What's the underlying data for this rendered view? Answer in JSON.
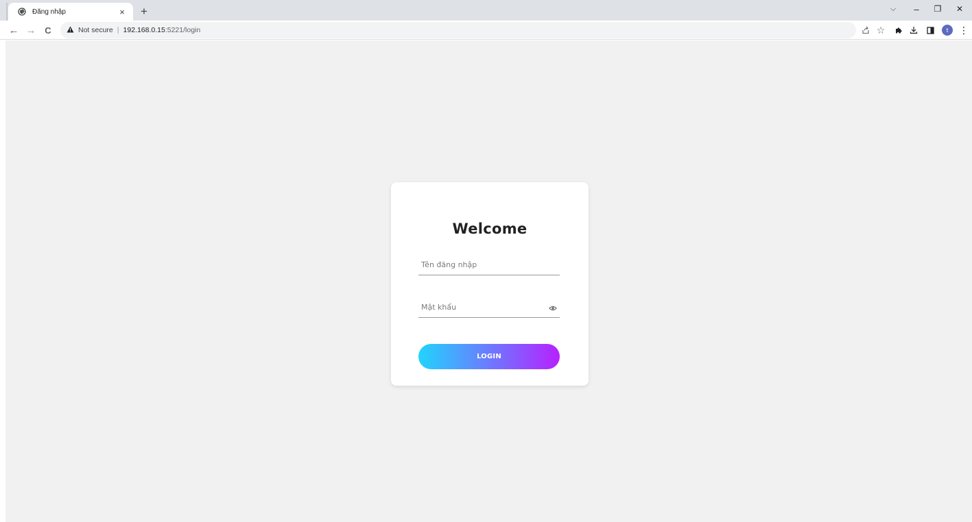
{
  "browser": {
    "tab": {
      "title": "Đăng nhập",
      "favicon": "globe-icon",
      "close": "×"
    },
    "new_tab": "+",
    "window_controls": {
      "tab_search": "⌵",
      "minimize": "–",
      "restore": "❐",
      "close": "✕"
    },
    "nav": {
      "back": "←",
      "forward": "→",
      "reload": "C"
    },
    "address": {
      "security_label": "Not secure",
      "separator": "|",
      "host": "192.168.0.15",
      "rest": ":5221/login"
    },
    "toolbar_icons": [
      "share-icon",
      "star-icon",
      "extensions-icon",
      "download-icon",
      "sidepanel-icon"
    ],
    "profile_initial": "t",
    "menu": "⋮"
  },
  "login": {
    "title": "Welcome",
    "username_placeholder": "Tên đăng nhập",
    "password_placeholder": "Mật khẩu",
    "button_label": "LOGIN",
    "colors": {
      "gradient_start": "#21d4fd",
      "gradient_end": "#b721ff",
      "page_bg": "#f1f1f1"
    }
  }
}
